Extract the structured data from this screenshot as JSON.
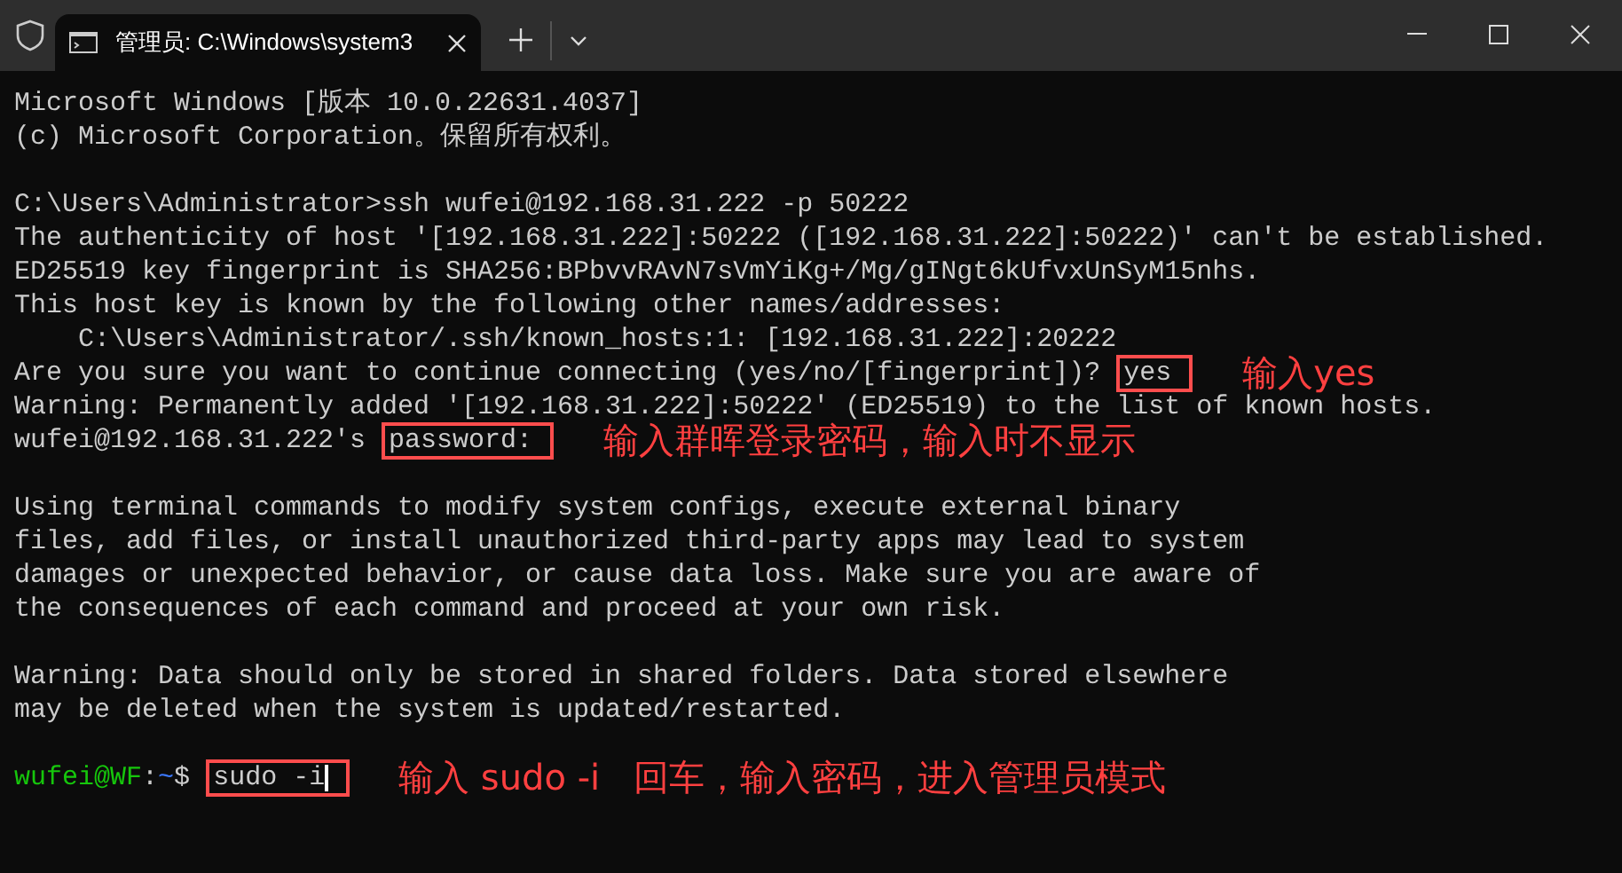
{
  "window": {
    "tab_title": "管理员: C:\\Windows\\system3"
  },
  "lines": [
    {
      "kind": "text",
      "text": "Microsoft Windows [版本 10.0.22631.4037]"
    },
    {
      "kind": "text",
      "text": "(c) Microsoft Corporation。保留所有权利。"
    },
    {
      "kind": "blank"
    },
    {
      "kind": "text",
      "text": "C:\\Users\\Administrator>ssh wufei@192.168.31.222 -p 50222"
    },
    {
      "kind": "text",
      "text": "The authenticity of host '[192.168.31.222]:50222 ([192.168.31.222]:50222)' can't be established."
    },
    {
      "kind": "text",
      "text": "ED25519 key fingerprint is SHA256:BPbvvRAvN7sVmYiKg+/Mg/gINgt6kUfvxUnSyM15nhs."
    },
    {
      "kind": "text",
      "text": "This host key is known by the following other names/addresses:"
    },
    {
      "kind": "text",
      "text": "    C:\\Users\\Administrator/.ssh/known_hosts:1: [192.168.31.222]:20222"
    },
    {
      "kind": "text",
      "text": "Are you sure you want to continue connecting (yes/no/[fingerprint])? ",
      "highlight": "yes",
      "note": "输入yes"
    },
    {
      "kind": "text",
      "text": "Warning: Permanently added '[192.168.31.222]:50222' (ED25519) to the list of known hosts."
    },
    {
      "kind": "text",
      "text": "wufei@192.168.31.222's ",
      "highlight": "password:",
      "note": "输入群晖登录密码，输入时不显示"
    },
    {
      "kind": "blank"
    },
    {
      "kind": "text",
      "text": "Using terminal commands to modify system configs, execute external binary"
    },
    {
      "kind": "text",
      "text": "files, add files, or install unauthorized third-party apps may lead to system"
    },
    {
      "kind": "text",
      "text": "damages or unexpected behavior, or cause data loss. Make sure you are aware of"
    },
    {
      "kind": "text",
      "text": "the consequences of each command and proceed at your own risk."
    },
    {
      "kind": "blank"
    },
    {
      "kind": "text",
      "text": "Warning: Data should only be stored in shared folders. Data stored elsewhere"
    },
    {
      "kind": "text",
      "text": "may be deleted when the system is updated/restarted."
    },
    {
      "kind": "blank"
    },
    {
      "kind": "prompt",
      "user": "wufei@WF",
      "sep": ":",
      "path": "~",
      "symbol": "$ ",
      "highlight": "sudo -i",
      "cursor": true,
      "note": "输入 sudo -i   回车，输入密码，进入管理员模式"
    }
  ]
}
